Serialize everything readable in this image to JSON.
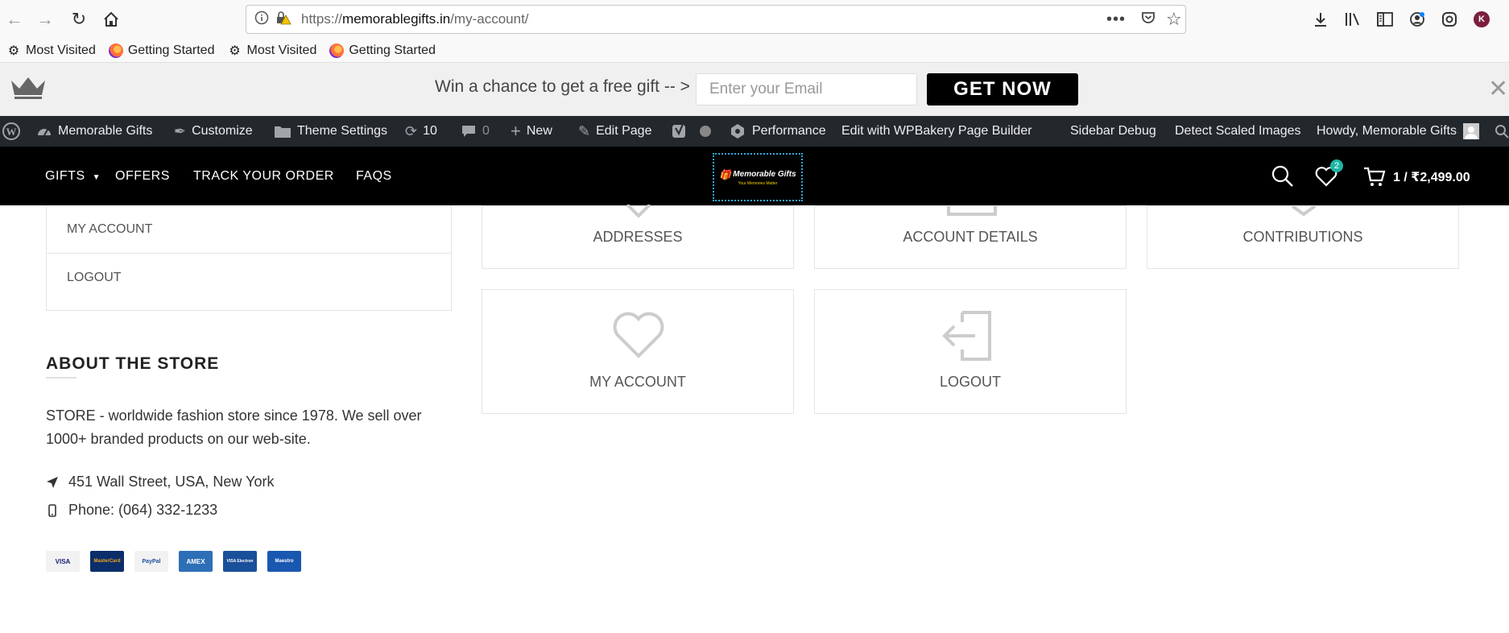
{
  "browser": {
    "url_scheme": "https://",
    "url_host": "memorablegifts.in",
    "url_path": "/my-account/",
    "bookmarks": [
      "Most Visited",
      "Getting Started",
      "Most Visited",
      "Getting Started"
    ]
  },
  "promo": {
    "text": "Win a chance to get a free gift -- >",
    "email_placeholder": "Enter your Email",
    "button_label": "GET NOW"
  },
  "wp_admin_bar": {
    "site_name": "Memorable Gifts",
    "customize": "Customize",
    "theme_settings": "Theme Settings",
    "updates_count": "10",
    "comments_count": "0",
    "new": "New",
    "edit_page": "Edit Page",
    "performance": "Performance",
    "wpbakery": "Edit with WPBakery Page Builder",
    "sidebar_debug": "Sidebar Debug",
    "detect_scaled": "Detect Scaled Images",
    "howdy": "Howdy, Memorable Gifts"
  },
  "header": {
    "menu": [
      "GIFTS",
      "OFFERS",
      "TRACK YOUR ORDER",
      "FAQS"
    ],
    "logo_text": "Memorable Gifts",
    "logo_tagline": "Your Memories Matter",
    "wishlist_count": "2",
    "cart_total": "1 / ₹2,499.00"
  },
  "sidebar": {
    "links": [
      "MY ACCOUNT",
      "LOGOUT"
    ],
    "about_title": "ABOUT THE STORE",
    "about_text": "STORE - worldwide fashion store since 1978. We sell over 1000+ branded products on our web-site.",
    "address": "451 Wall Street, USA, New York",
    "phone": "Phone: (064) 332-1233",
    "payment_cards": [
      "VISA",
      "MasterCard",
      "PayPal",
      "AMEX",
      "VISA Electron",
      "Maestro"
    ]
  },
  "tiles": {
    "addresses": "ADDRESSES",
    "account_details": "ACCOUNT DETAILS",
    "contributions": "CONTRIBUTIONS",
    "my_account": "MY ACCOUNT",
    "logout": "LOGOUT"
  },
  "colors": {
    "wp_bar": "#23282d",
    "header_bg": "#000000",
    "badge": "#1fb5a6",
    "promo_bg": "#f0f0f0"
  }
}
